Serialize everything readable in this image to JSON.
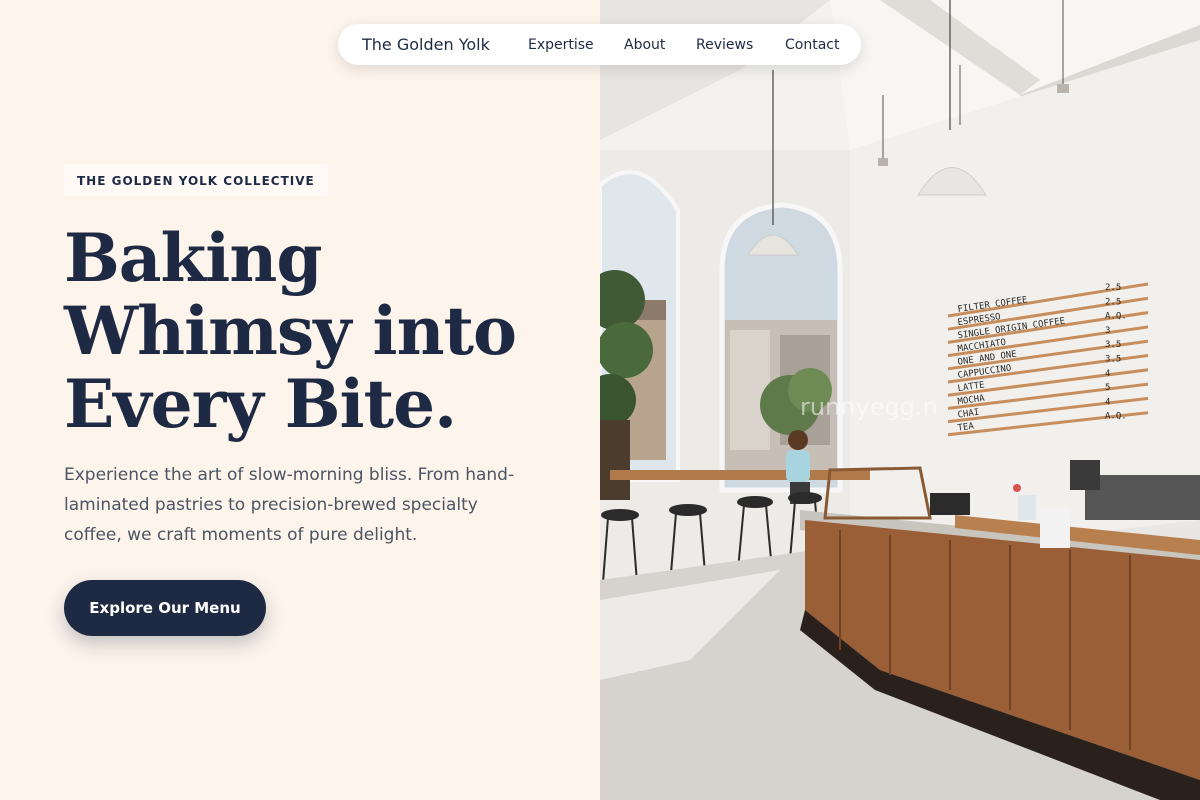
{
  "nav": {
    "brand": "The Golden Yolk",
    "links": [
      "Expertise",
      "About",
      "Reviews",
      "Contact"
    ]
  },
  "hero": {
    "eyebrow": "THE GOLDEN YOLK COLLECTIVE",
    "headline_lines": [
      "Baking",
      "Whimsy into",
      "Every Bite."
    ],
    "subtext": "Experience the art of slow-morning bliss. From hand-laminated pastries to precision-brewed specialty coffee, we craft moments of pure delight.",
    "cta_label": "Explore Our Menu"
  },
  "photo": {
    "menu_board": [
      {
        "item": "FILTER COFFEE",
        "price": "2.5"
      },
      {
        "item": "ESPRESSO",
        "price": "2.5"
      },
      {
        "item": "SINGLE ORIGIN COFFEE",
        "price": "A.Q."
      },
      {
        "item": "MACCHIATO",
        "price": "3"
      },
      {
        "item": "ONE AND ONE",
        "price": "3.5"
      },
      {
        "item": "CAPPUCCINO",
        "price": "3.5"
      },
      {
        "item": "LATTE",
        "price": "4"
      },
      {
        "item": "MOCHA",
        "price": "5"
      },
      {
        "item": "CHAI",
        "price": "4"
      },
      {
        "item": "TEA",
        "price": "A.Q."
      }
    ],
    "watermark": "runnyegg.n"
  },
  "colors": {
    "navy": "#1e2a44",
    "cream": "#fdf4ec",
    "body_text": "#4b5563",
    "wood": "#9a5f36"
  }
}
